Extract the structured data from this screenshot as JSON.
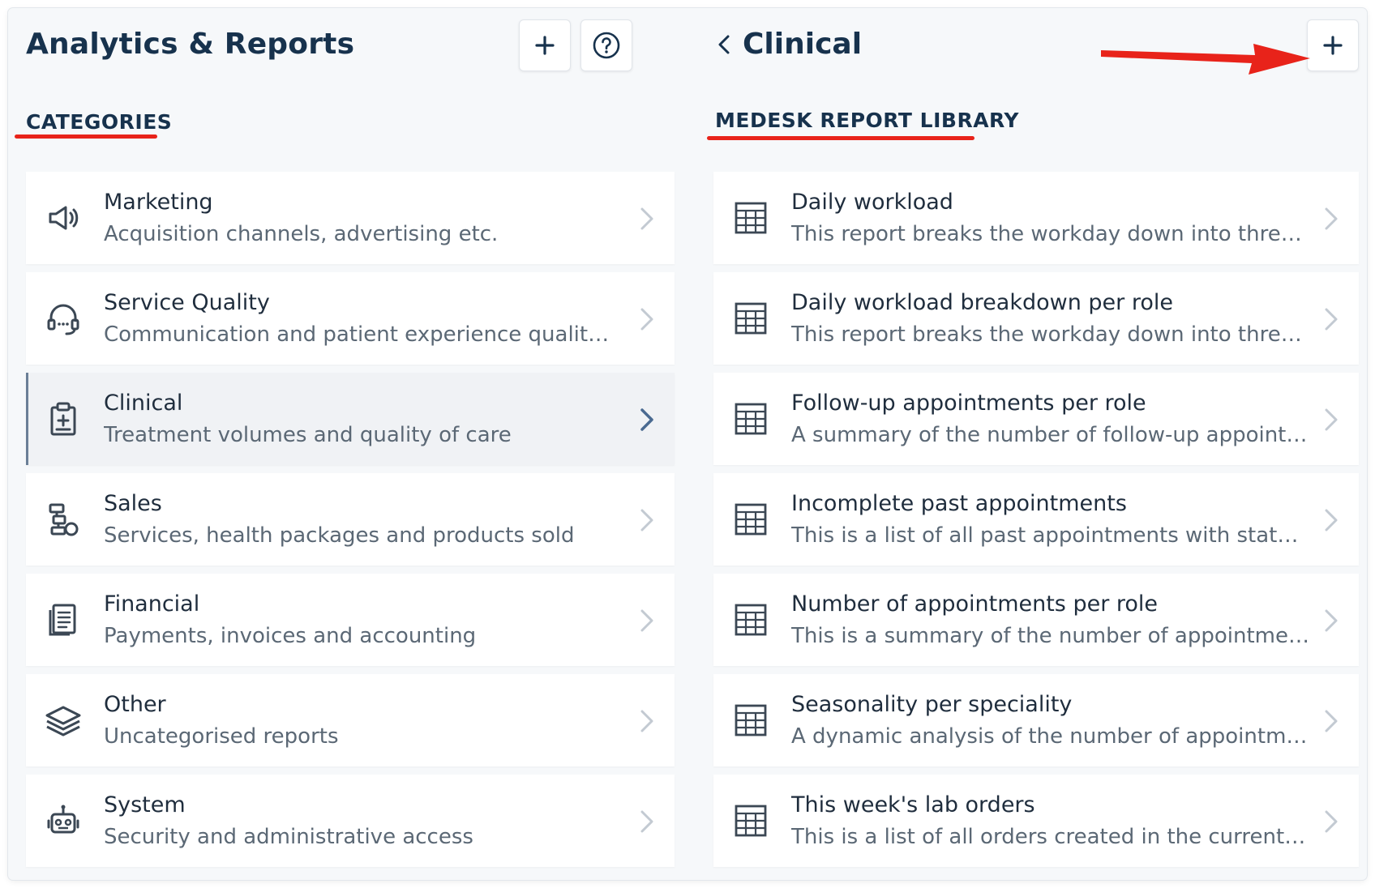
{
  "left": {
    "title": "Analytics & Reports",
    "add_button": "add",
    "help_button": "help",
    "section_title": "CATEGORIES",
    "categories": [
      {
        "label": "Marketing",
        "desc": "Acquisition channels, advertising etc.",
        "icon": "megaphone-icon"
      },
      {
        "label": "Service Quality",
        "desc": "Communication and patient experience quality co...",
        "icon": "headset-icon"
      },
      {
        "label": "Clinical",
        "desc": "Treatment volumes and quality of care",
        "icon": "clipboard-plus-icon",
        "selected": true
      },
      {
        "label": "Sales",
        "desc": "Services, health packages and products sold",
        "icon": "sales-boxes-icon"
      },
      {
        "label": "Financial",
        "desc": "Payments, invoices and accounting",
        "icon": "document-icon"
      },
      {
        "label": "Other",
        "desc": "Uncategorised reports",
        "icon": "layers-icon"
      },
      {
        "label": "System",
        "desc": "Security and administrative access",
        "icon": "robot-icon"
      }
    ]
  },
  "right": {
    "title": "Clinical",
    "section_title": "MEDESK REPORT LIBRARY",
    "reports": [
      {
        "label": "Daily workload",
        "desc": "This report breaks the workday down into three-h..."
      },
      {
        "label": "Daily workload breakdown per role",
        "desc": "This report breaks the workday down into three-h..."
      },
      {
        "label": "Follow-up appointments per role",
        "desc": "A summary of the number of follow-up appointm..."
      },
      {
        "label": "Incomplete past appointments",
        "desc": "This is a list of all past appointments with statuses..."
      },
      {
        "label": "Number of appointments per role",
        "desc": "This is a summary of the number of appointments..."
      },
      {
        "label": "Seasonality per speciality",
        "desc": "A dynamic analysis of the number of appointment..."
      },
      {
        "label": "This week's lab orders",
        "desc": "This is a list of all orders created in the current we..."
      }
    ]
  },
  "colors": {
    "accent_red": "#e8231a",
    "title": "#17324d",
    "text_muted": "#5b6875"
  }
}
